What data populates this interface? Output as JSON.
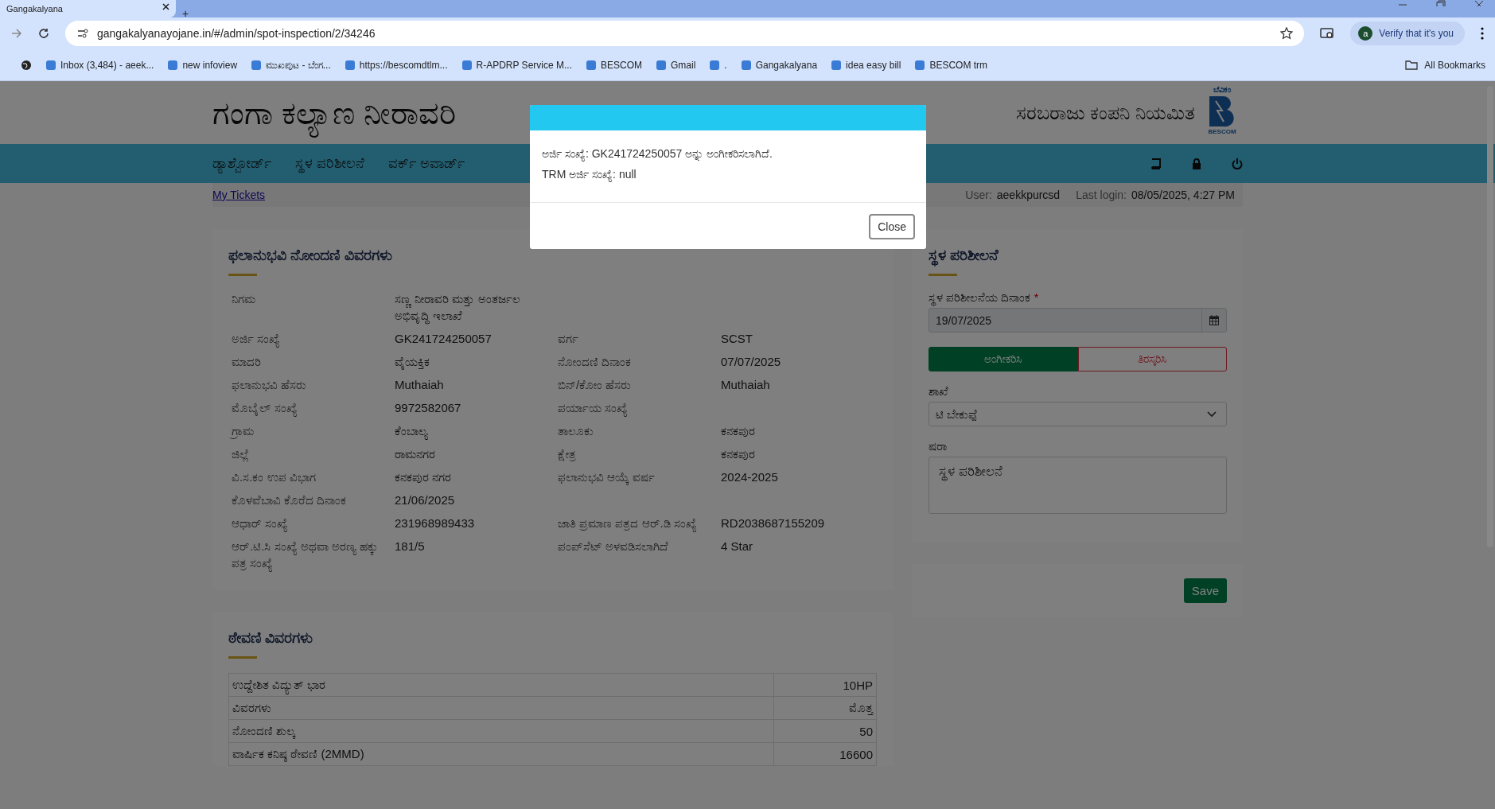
{
  "browser": {
    "tab_title": "Gangakalyana",
    "new_tab": "+",
    "url": "gangakalyanayojane.in/#/admin/spot-inspection/2/34246",
    "verify": "Verify that it's you",
    "avatar": "a",
    "bookmarks": [
      {
        "label": "Inbox (3,484) - aeek..."
      },
      {
        "label": "new infoview"
      },
      {
        "label": "ಮುಖಪುಟ - ಬೆಂಗ..."
      },
      {
        "label": "https://bescomdtlm..."
      },
      {
        "label": "R-APDRP Service M..."
      },
      {
        "label": "BESCOM"
      },
      {
        "label": "Gmail"
      },
      {
        "label": "."
      },
      {
        "label": "Gangakalyana"
      },
      {
        "label": "idea easy bill"
      },
      {
        "label": "BESCOM trm"
      }
    ],
    "all_bookmarks": "All Bookmarks"
  },
  "header": {
    "title": "ಗಂಗಾ ಕಲ್ಯಾಣ ನೀರಾವರಿ",
    "company": "ಸರಬರಾಜು ಕಂಪನಿ ನಿಯಮಿತ",
    "logo_top": "ಬೆವಿಕಂ",
    "logo_bottom": "BESCOM"
  },
  "nav": {
    "items": [
      {
        "label": "ಡ್ಯಾಶ್ಬೋರ್ಡ್"
      },
      {
        "label": "ಸ್ಥಳ ಪರಿಶೀಲನೆ"
      },
      {
        "label": "ವರ್ಕ್ ಅವಾರ್ಡ್"
      }
    ]
  },
  "subbar": {
    "link": "My Tickets",
    "user_label": "User:",
    "user": "aeekkpurcsd",
    "login_label": "Last login:",
    "login": "08/05/2025, 4:27 PM"
  },
  "details": {
    "title": "ಫಲಾನುಭವಿ ನೋಂದಣಿ ವಿವರಗಳು",
    "rows": [
      [
        "ನಿಗಮ",
        "ಸಣ್ಣ ನೀರಾವರಿ ಮತ್ತು ಅಂತರ್ಜಲ ಅಭಿವೃದ್ಧಿ ಇಲಾಖೆ",
        "",
        ""
      ],
      [
        "ಅರ್ಜಿ ಸಂಖ್ಯೆ",
        "GK241724250057",
        "ವರ್ಗ",
        "SCST"
      ],
      [
        "ಮಾದರಿ",
        "ವೈಯಕ್ತಿಕ",
        "ನೋಂದಣಿ ದಿನಾಂಕ",
        "07/07/2025"
      ],
      [
        "ಫಲಾನುಭವಿ ಹೆಸರು",
        "Muthaiah",
        "ಬಿನ್/ಕೋಂ ಹೆಸರು",
        "Muthaiah"
      ],
      [
        "ಮೊಬೈಲ್ ಸಂಖ್ಯೆ",
        "9972582067",
        "ಪರ್ಯಾಯ ಸಂಖ್ಯೆ",
        ""
      ],
      [
        "ಗ್ರಾಮ",
        "ಕೆಂಬಾಲ್ಯ",
        "ತಾಲೂಕು",
        "ಕನಕಪುರ"
      ],
      [
        "ಜಿಲ್ಲೆ",
        "ರಾಮನಗರ",
        "ಕ್ಷೇತ್ರ",
        "ಕನಕಪುರ"
      ],
      [
        "ವಿ.ಸ.ಕಂ ಉಪ ವಿಭಾಗ",
        "ಕನಕಪುರ ನಗರ",
        "ಫಲಾನುಭವಿ ಆಯ್ಕೆ ವರ್ಷ",
        "2024-2025"
      ],
      [
        "ಕೊಳವೆಬಾವಿ ಕೊರೆದ ದಿನಾಂಕ",
        "21/06/2025",
        "",
        ""
      ],
      [
        "ಆಧಾರ್ ಸಂಖ್ಯೆ",
        "231968989433",
        "ಜಾತಿ ಪ್ರಮಾಣ ಪತ್ರದ ಆರ್.ಡಿ ಸಂಖ್ಯೆ",
        "RD2038687155209"
      ],
      [
        "ಆರ್.ಟಿ.ಸಿ ಸಂಖ್ಯೆ ಅಥವಾ ಅರಣ್ಯ ಹಕ್ಕು ಪತ್ರ ಸಂಖ್ಯೆ",
        "181/5",
        "ಪಂಪ್‌ಸೆಟ್ ಅಳವಡಿಸಲಾಗಿದೆ",
        "4 Star"
      ]
    ]
  },
  "inspection": {
    "title": "ಸ್ಥಳ ಪರಿಶೀಲನೆ",
    "date_label": "ಸ್ಥಳ ಪರಿಶೀಲನೆಯ ದಿನಾಂಕ",
    "required": "*",
    "date_value": "19/07/2025",
    "decision": [
      {
        "label": "ಅಂಗೀಕರಿಸಿ",
        "selected": true
      },
      {
        "label": "ತಿರಸ್ಕರಿಸಿ",
        "selected": false
      }
    ],
    "branch_label": "ಶಾಖೆ",
    "branch_value": "ಟಿ ಬೇಕುಪ್ಪೆ",
    "remarks_label": "ಷರಾ",
    "remarks_value": "ಸ್ಥಳ ಪರಿಶೀಲನೆ",
    "save": "Save"
  },
  "charges": {
    "title": "ಠೇವಣಿ ವಿವರಗಳು",
    "rows": [
      {
        "label": "ಉದ್ದೇಶಿತ ವಿದ್ಯುತ್ ಭಾರ",
        "value": "10HP"
      },
      {
        "label": "ವಿವರಗಳು",
        "value": "ಮೊತ್ತ"
      },
      {
        "label": "ನೋಂದಣಿ ಶುಲ್ಕ",
        "value": "50"
      },
      {
        "label": "ವಾರ್ಷಿಕ ಕನಿಷ್ಠ ಠೇವಣಿ (2MMD)",
        "value": "16600"
      }
    ]
  },
  "modal": {
    "lines": [
      "ಅರ್ಜಿ ಸಂಖ್ಯೆ: GK241724250057 ಅನ್ನು ಅಂಗೀಕರಿಸಲಾಗಿದೆ.",
      "TRM ಅರ್ಜಿ ಸಂಖ್ಯೆ: null"
    ],
    "close": "Close"
  }
}
